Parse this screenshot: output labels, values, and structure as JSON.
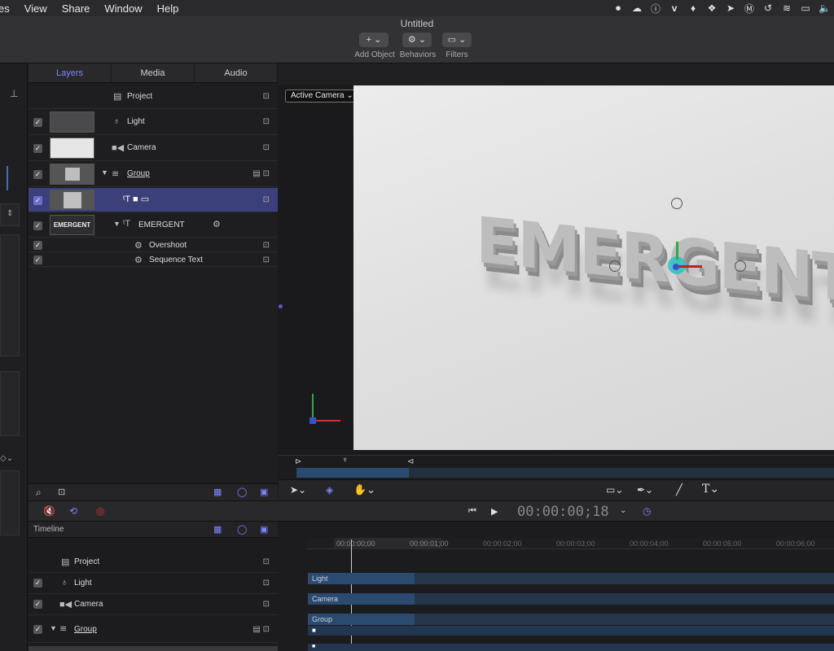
{
  "menubar": {
    "items": [
      "es",
      "View",
      "Share",
      "Window",
      "Help"
    ],
    "status_icons": [
      "camera-record-icon",
      "cloud-icon",
      "info-icon",
      "vimeo-icon",
      "flame-icon",
      "dropbox-icon",
      "arrow-icon",
      "m-icon",
      "history-icon",
      "wifi-icon",
      "airplay-icon",
      "volume-icon"
    ]
  },
  "toolbar": {
    "title": "Untitled",
    "add_object": {
      "glyph": "+ ⌄",
      "label": "Add Object"
    },
    "behaviors": {
      "glyph": "⚙ ⌄",
      "label": "Behaviors"
    },
    "filters": {
      "glyph": "▭ ⌄",
      "label": "Filters"
    }
  },
  "layers": {
    "tabs": [
      "Layers",
      "Media",
      "Audio"
    ],
    "active_tab": "Layers",
    "rows": [
      {
        "name": "Project",
        "checked": false
      },
      {
        "name": "Light",
        "checked": true
      },
      {
        "name": "Camera",
        "checked": true
      },
      {
        "name": "Group",
        "checked": true
      },
      {
        "name": "",
        "checked": true
      },
      {
        "name": "EMERGENT",
        "checked": true
      },
      {
        "name": "Overshoot",
        "checked": true
      },
      {
        "name": "Sequence Text",
        "checked": true
      }
    ],
    "thumb_text": "EMERGENT"
  },
  "canvas": {
    "camera_menu": "Active Camera ⌄",
    "scene_text": "EMERGENT"
  },
  "transport": {
    "timecode": "00:00:00;18"
  },
  "timeline": {
    "header": "Timeline",
    "ruler_ticks": [
      "00:00:00;00",
      "00:00:01;00",
      "00:00:02;00",
      "00:00:03;00",
      "00:00:04;00",
      "00:00:05;00",
      "00:00:06;00"
    ],
    "rows": [
      {
        "name": "Project",
        "checked": false
      },
      {
        "name": "Light",
        "checked": true
      },
      {
        "name": "Camera",
        "checked": true
      },
      {
        "name": "Group",
        "checked": true
      }
    ],
    "tracks": [
      "Light",
      "Camera",
      "Group"
    ]
  }
}
